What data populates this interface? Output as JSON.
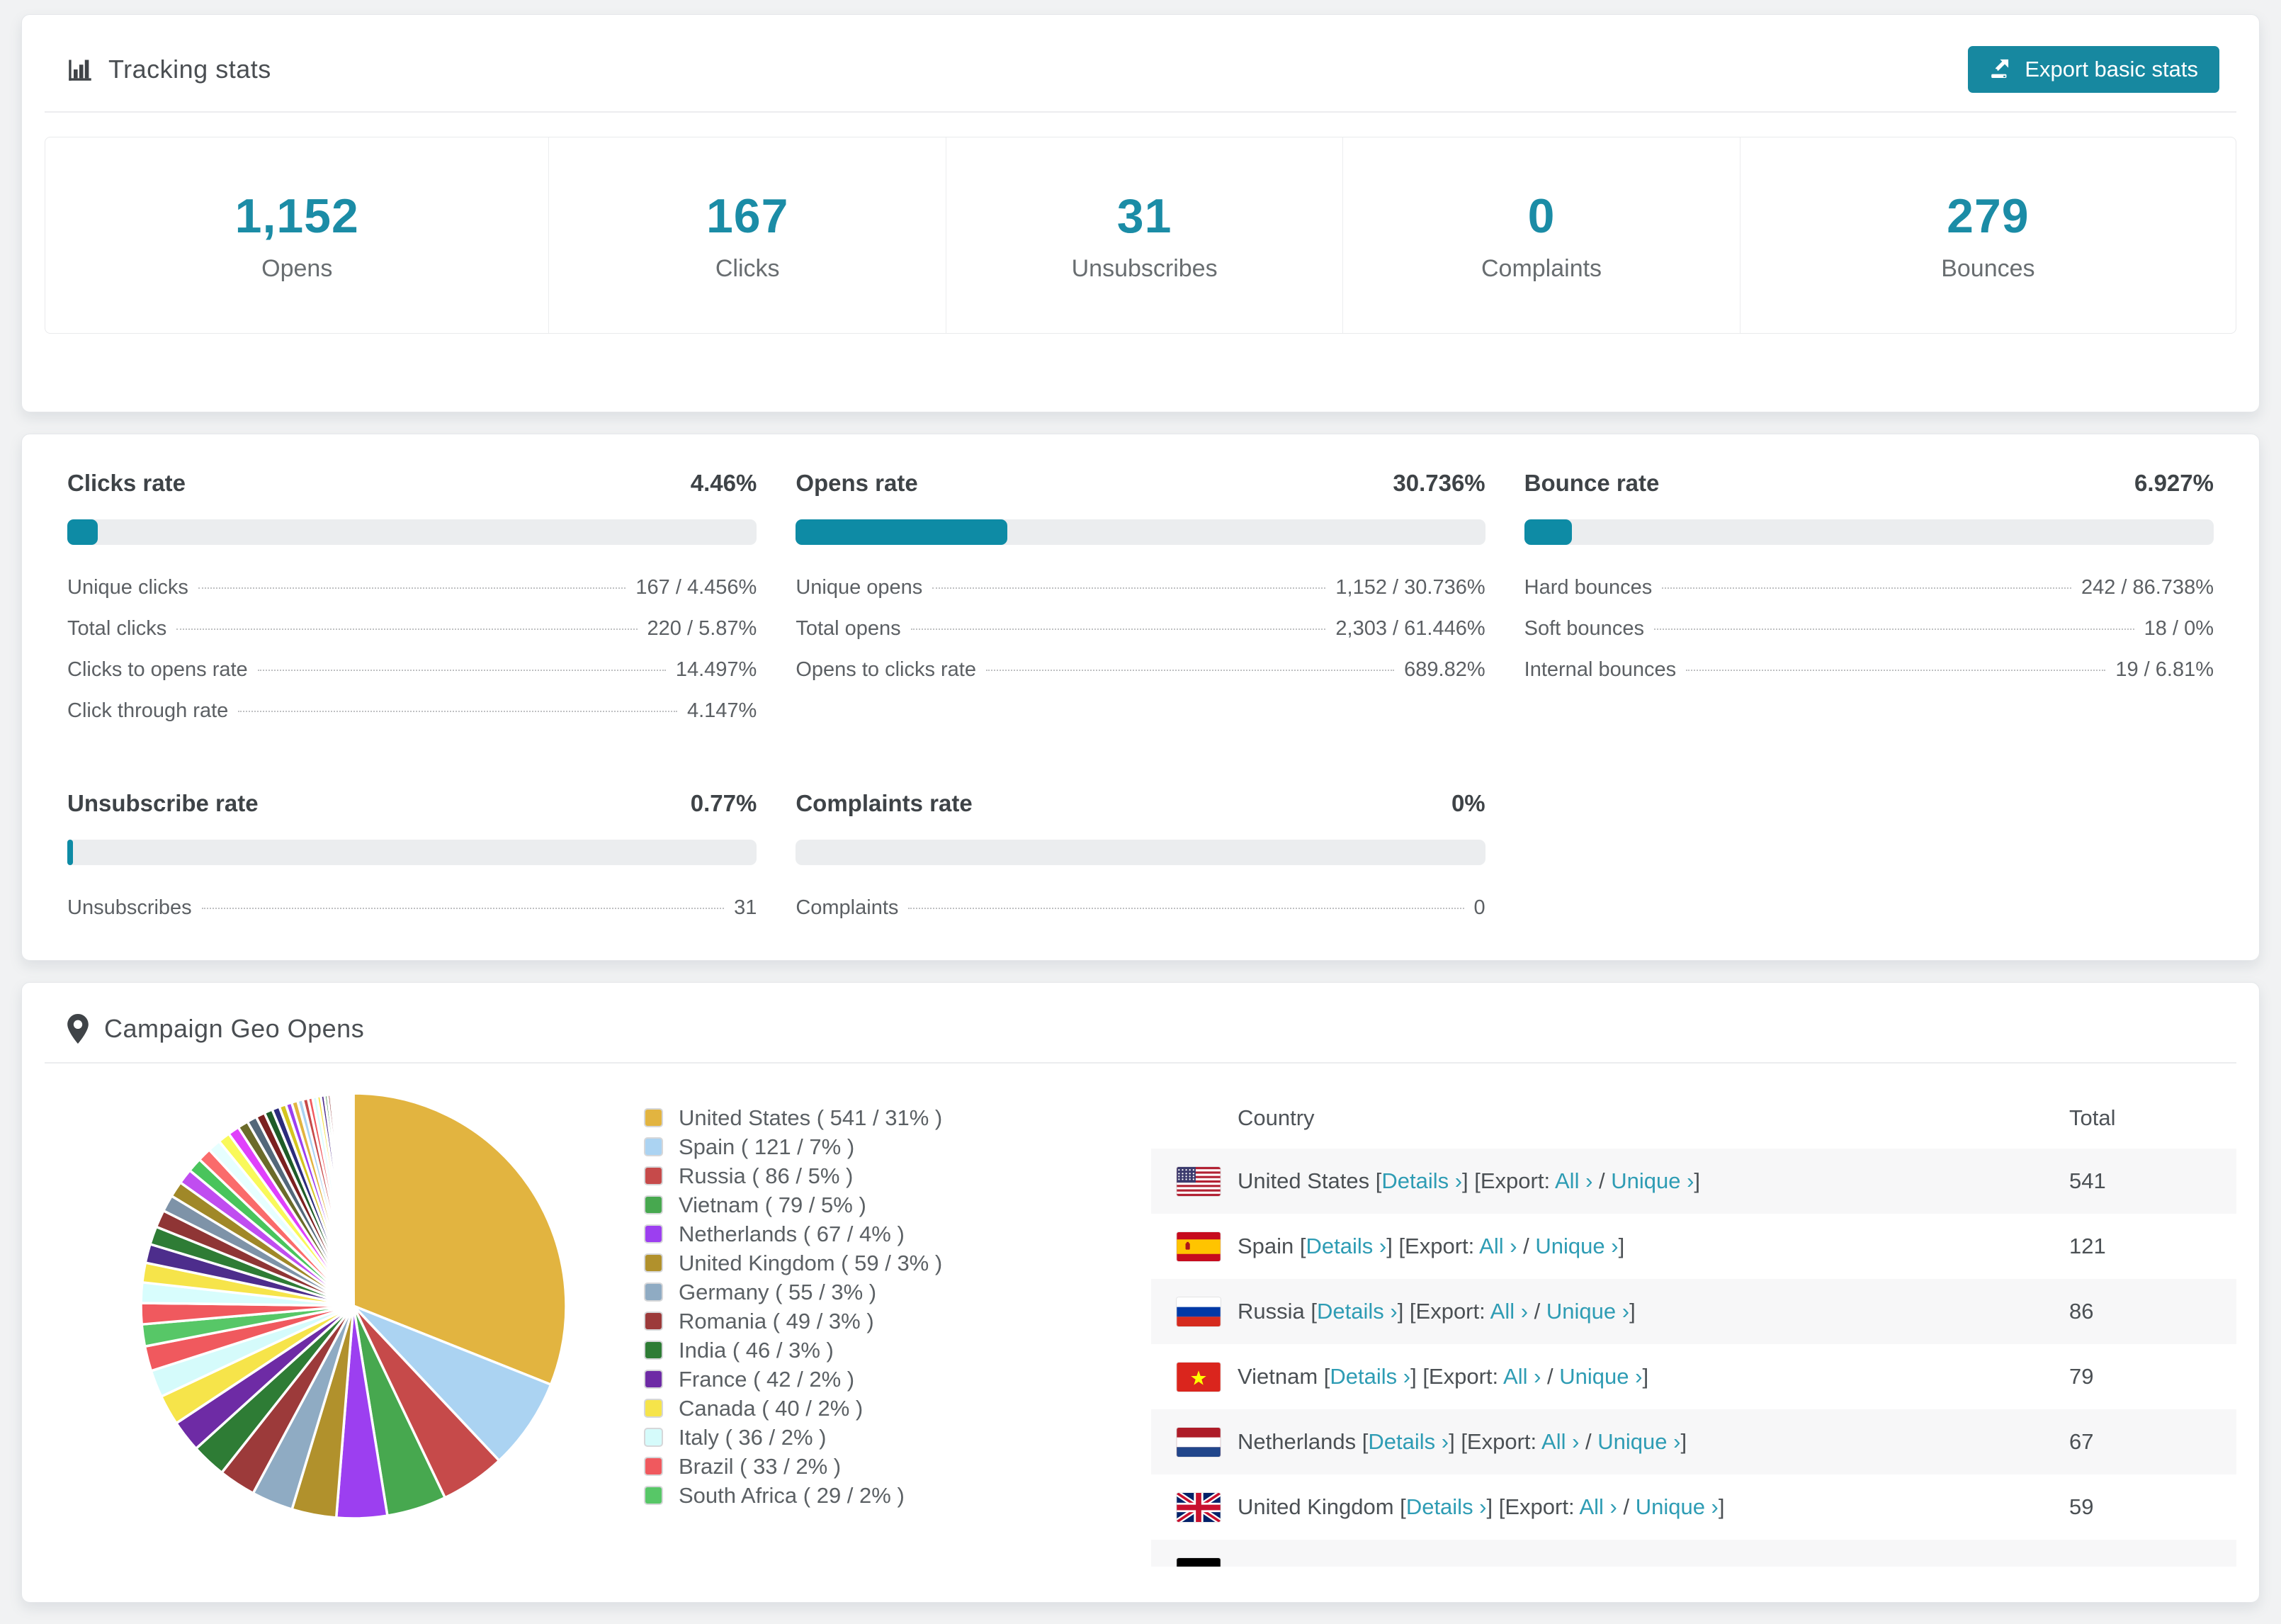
{
  "accent": {
    "teal_number": "#1b8ca6",
    "teal_button": "#1788a0",
    "teal_bar": "#0e8ba5",
    "teal_link": "#2e9cb4",
    "bar_track": "#ebedef"
  },
  "tracking": {
    "title": "Tracking stats",
    "export_label": "Export basic stats",
    "stats": [
      {
        "value": "1,152",
        "label": "Opens"
      },
      {
        "value": "167",
        "label": "Clicks"
      },
      {
        "value": "31",
        "label": "Unsubscribes"
      },
      {
        "value": "0",
        "label": "Complaints"
      },
      {
        "value": "279",
        "label": "Bounces"
      }
    ]
  },
  "rates": [
    {
      "title": "Clicks rate",
      "value": "4.46%",
      "pct": 4.46,
      "rows": [
        {
          "label": "Unique clicks",
          "value": "167 / 4.456%"
        },
        {
          "label": "Total clicks",
          "value": "220 / 5.87%"
        },
        {
          "label": "Clicks to opens rate",
          "value": "14.497%"
        },
        {
          "label": "Click through rate",
          "value": "4.147%"
        }
      ]
    },
    {
      "title": "Opens rate",
      "value": "30.736%",
      "pct": 30.736,
      "rows": [
        {
          "label": "Unique opens",
          "value": "1,152 / 30.736%"
        },
        {
          "label": "Total opens",
          "value": "2,303 / 61.446%"
        },
        {
          "label": "Opens to clicks rate",
          "value": "689.82%"
        }
      ]
    },
    {
      "title": "Bounce rate",
      "value": "6.927%",
      "pct": 6.927,
      "rows": [
        {
          "label": "Hard bounces",
          "value": "242 / 86.738%"
        },
        {
          "label": "Soft bounces",
          "value": "18 / 0%"
        },
        {
          "label": "Internal bounces",
          "value": "19 / 6.81%"
        }
      ]
    },
    {
      "title": "Unsubscribe rate",
      "value": "0.77%",
      "pct": 0.77,
      "rows": [
        {
          "label": "Unsubscribes",
          "value": "31"
        }
      ]
    },
    {
      "title": "Complaints rate",
      "value": "0%",
      "pct": 0,
      "rows": [
        {
          "label": "Complaints",
          "value": "0"
        }
      ]
    }
  ],
  "geo": {
    "title": "Campaign Geo Opens",
    "columns": [
      "Country",
      "Total"
    ],
    "links": {
      "open": "[",
      "details": "Details ›",
      "close_open": "] [Export: ",
      "all": "All ›",
      "sep": " / ",
      "unique": "Unique ›",
      "close": "]"
    },
    "rows": [
      {
        "country": "United States",
        "flag": "us",
        "total": "541"
      },
      {
        "country": "Spain",
        "flag": "es",
        "total": "121"
      },
      {
        "country": "Russia",
        "flag": "ru",
        "total": "86"
      },
      {
        "country": "Vietnam",
        "flag": "vn",
        "total": "79"
      },
      {
        "country": "Netherlands",
        "flag": "nl",
        "total": "67"
      },
      {
        "country": "United Kingdom",
        "flag": "gb",
        "total": "59"
      },
      {
        "country": "",
        "flag": "de",
        "total": "",
        "partial": true
      }
    ]
  },
  "chart_data": {
    "type": "pie",
    "title": "Campaign Geo Opens",
    "legend_position": "right",
    "start_angle_deg": -90,
    "direction": "clockwise",
    "slices": [
      {
        "label": "United States",
        "value": 541,
        "pct": "31%",
        "color": "#e2b440"
      },
      {
        "label": "Spain",
        "value": 121,
        "pct": "7%",
        "color": "#abd3f2"
      },
      {
        "label": "Russia",
        "value": 86,
        "pct": "5%",
        "color": "#c64a4a"
      },
      {
        "label": "Vietnam",
        "value": 79,
        "pct": "5%",
        "color": "#47a84f"
      },
      {
        "label": "Netherlands",
        "value": 67,
        "pct": "4%",
        "color": "#9c3ff0"
      },
      {
        "label": "United Kingdom",
        "value": 59,
        "pct": "3%",
        "color": "#b1912c"
      },
      {
        "label": "Germany",
        "value": 55,
        "pct": "3%",
        "color": "#8fabc3"
      },
      {
        "label": "Romania",
        "value": 49,
        "pct": "3%",
        "color": "#9c3a3a"
      },
      {
        "label": "India",
        "value": 46,
        "pct": "3%",
        "color": "#2e7c35"
      },
      {
        "label": "France",
        "value": 42,
        "pct": "2%",
        "color": "#6e2ba5"
      },
      {
        "label": "Canada",
        "value": 40,
        "pct": "2%",
        "color": "#f6e44a"
      },
      {
        "label": "Italy",
        "value": 36,
        "pct": "2%",
        "color": "#d5fbfb"
      },
      {
        "label": "Brazil",
        "value": 33,
        "pct": "2%",
        "color": "#f0595e"
      },
      {
        "label": "South Africa",
        "value": 29,
        "pct": "2%",
        "color": "#57c767"
      }
    ],
    "others_unlabeled": [
      28,
      27,
      26,
      25,
      24,
      23,
      22,
      21,
      20,
      19,
      18,
      17,
      16,
      15,
      14,
      13,
      12,
      11,
      10,
      9,
      8,
      8,
      7,
      7,
      6,
      6,
      5,
      5,
      4,
      4,
      3,
      3,
      3,
      2,
      2,
      2,
      2,
      1,
      1,
      1,
      1,
      1,
      1,
      1,
      1,
      1,
      1,
      1,
      1,
      1
    ],
    "others_palette": [
      "#f0595e",
      "#d8fdfd",
      "#f6e44a",
      "#4d2d8c",
      "#2e7c35",
      "#8f3535",
      "#7e93a8",
      "#a08828",
      "#c04df0",
      "#49c45c",
      "#fa6b6b",
      "#e6ffff",
      "#f9f95a",
      "#e040fb",
      "#6b6b2a",
      "#53687a",
      "#7c2020",
      "#1f5c28",
      "#2c2c7c",
      "#d4c51f",
      "#9c3ff0",
      "#e2b440",
      "#abd3f2",
      "#c64a4a"
    ]
  }
}
